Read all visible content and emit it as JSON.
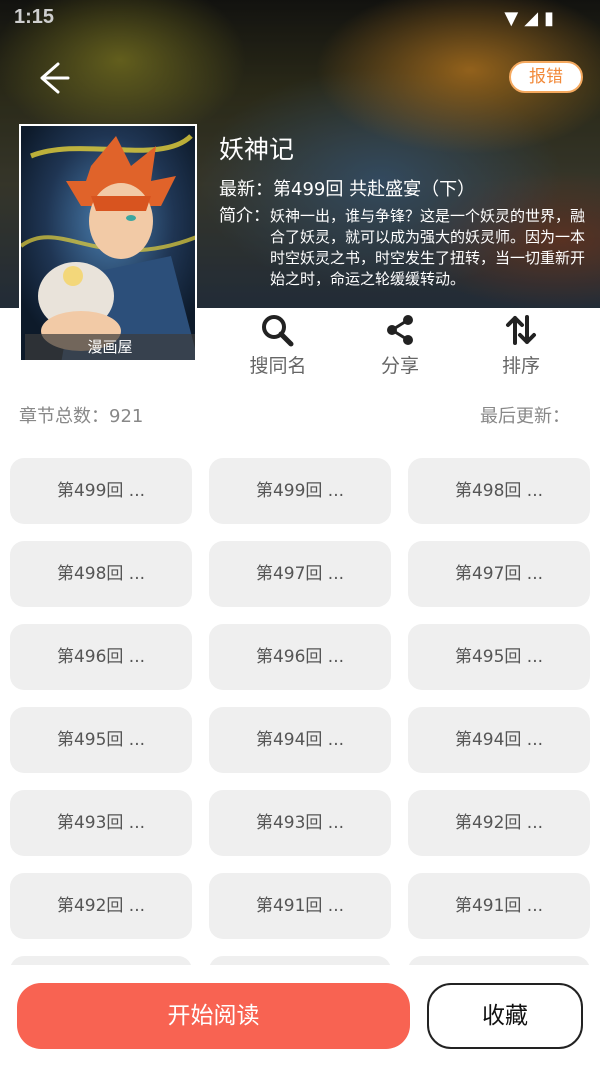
{
  "status_bar": {
    "time": "1:15",
    "icons": [
      "wifi-icon",
      "signal-icon",
      "battery-icon"
    ]
  },
  "header": {
    "back_icon": "arrow-left-icon",
    "report_label": "报错",
    "title": "妖神记",
    "latest": "最新：第499回 共赴盛宴（下）",
    "intro_label": "简介：",
    "intro_text": "妖神一出，谁与争锋？这是一个妖灵的世界，融合了妖灵，就可以成为强大的妖灵师。因为一本时空妖灵之书，时空发生了扭转，当一切重新开始之时，命运之轮缓缓转动。",
    "cover_source": "漫画屋"
  },
  "actions": [
    {
      "icon": "search-icon",
      "label": "搜同名"
    },
    {
      "icon": "share-icon",
      "label": "分享"
    },
    {
      "icon": "sort-icon",
      "label": "排序"
    }
  ],
  "info": {
    "chapter_count": "章节总数：921",
    "last_update": "最后更新："
  },
  "chapters": [
    "第499回 ...",
    "第499回 ...",
    "第498回 ...",
    "第498回 ...",
    "第497回 ...",
    "第497回 ...",
    "第496回 ...",
    "第496回 ...",
    "第495回 ...",
    "第495回 ...",
    "第494回 ...",
    "第494回 ...",
    "第493回 ...",
    "第493回 ...",
    "第492回 ...",
    "第492回 ...",
    "第491回 ...",
    "第491回 ...",
    "",
    "",
    ""
  ],
  "bottom": {
    "read_label": "开始阅读",
    "favorite_label": "收藏"
  },
  "colors": {
    "accent": "#f86352",
    "report_border": "#f5a95f",
    "chip_bg": "#efefef"
  }
}
